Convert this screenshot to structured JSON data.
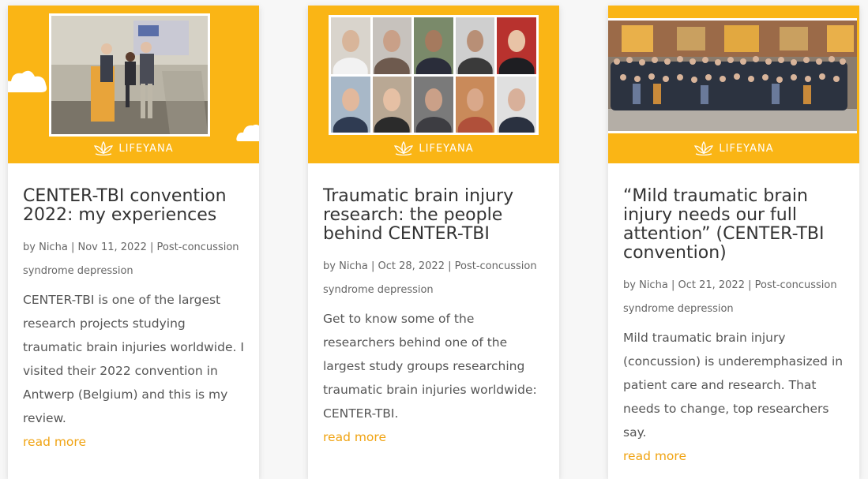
{
  "brand": {
    "name": "LIFEYANA"
  },
  "posts": [
    {
      "title": "CENTER-TBI convention 2022: my experiences",
      "author": "Nicha",
      "date": "Nov 11, 2022",
      "category": "Post-concussion syndrome depression",
      "excerpt": "CENTER-TBI is one of the largest research projects studying traumatic brain injuries worldwide. I visited their 2022 convention in Antwerp (Belgium) and this is my review.",
      "read_more": "read more"
    },
    {
      "title": "Traumatic brain injury research: the people behind CENTER-TBI",
      "author": "Nicha",
      "date": "Oct 28, 2022",
      "category": "Post-concussion syndrome depression",
      "excerpt": "Get to know some of the researchers behind one of the largest study groups researching traumatic brain injuries worldwide: CENTER-TBI.",
      "read_more": "read more"
    },
    {
      "title": "“Mild traumatic brain injury needs our full attention” (CENTER-TBI convention)",
      "author": "Nicha",
      "date": "Oct 21, 2022",
      "category": "Post-concussion syndrome depression",
      "excerpt": "Mild traumatic brain injury (concussion) is underemphasized in patient care and research. That needs to change, top researchers say.",
      "read_more": "read more"
    }
  ],
  "meta_by": "by",
  "meta_sep": "|",
  "colors": {
    "banner": "#fab515",
    "link": "#f0a312",
    "text": "#555555"
  }
}
